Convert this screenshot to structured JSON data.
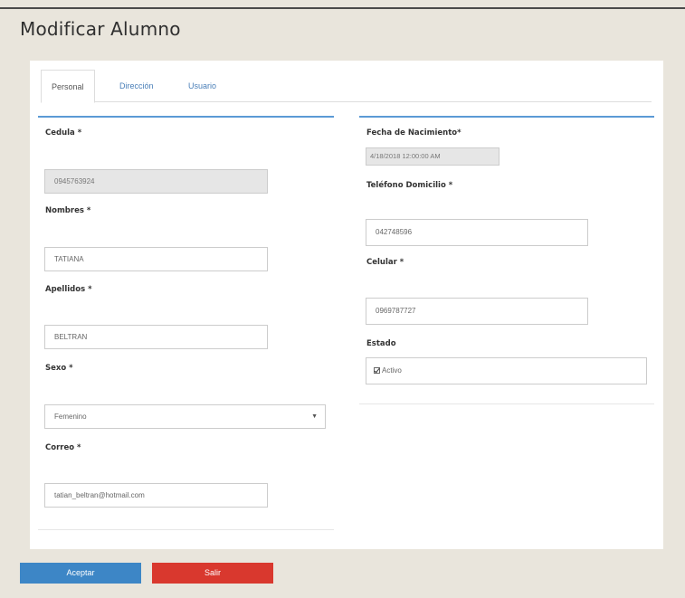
{
  "page": {
    "title": "Modificar Alumno"
  },
  "tabs": [
    {
      "label": "Personal",
      "active": true
    },
    {
      "label": "Dirección",
      "active": false
    },
    {
      "label": "Usuario",
      "active": false
    }
  ],
  "left": {
    "cedula_label": "Cedula *",
    "cedula_value": "0945763924",
    "nombres_label": "Nombres *",
    "nombres_value": "TATIANA",
    "apellidos_label": "Apellidos *",
    "apellidos_value": "BELTRAN",
    "sexo_label": "Sexo *",
    "sexo_value": "Femenino",
    "correo_label": "Correo *",
    "correo_value": "tatian_beltran@hotmail.com"
  },
  "right": {
    "fecha_label": "Fecha de Nacimiento*",
    "fecha_value": "4/18/2018 12:00:00 AM",
    "telefono_label": "Teléfono Domicilio *",
    "telefono_value": "042748596",
    "celular_label": "Celular *",
    "celular_value": "0969787727",
    "estado_label": "Estado",
    "estado_option": "Activo",
    "estado_checked": true
  },
  "buttons": {
    "accept": "Aceptar",
    "exit": "Salir"
  },
  "colors": {
    "accent": "#5b9ad5",
    "accept": "#3d86c6",
    "exit": "#d9382e",
    "background": "#e9e5dc"
  }
}
